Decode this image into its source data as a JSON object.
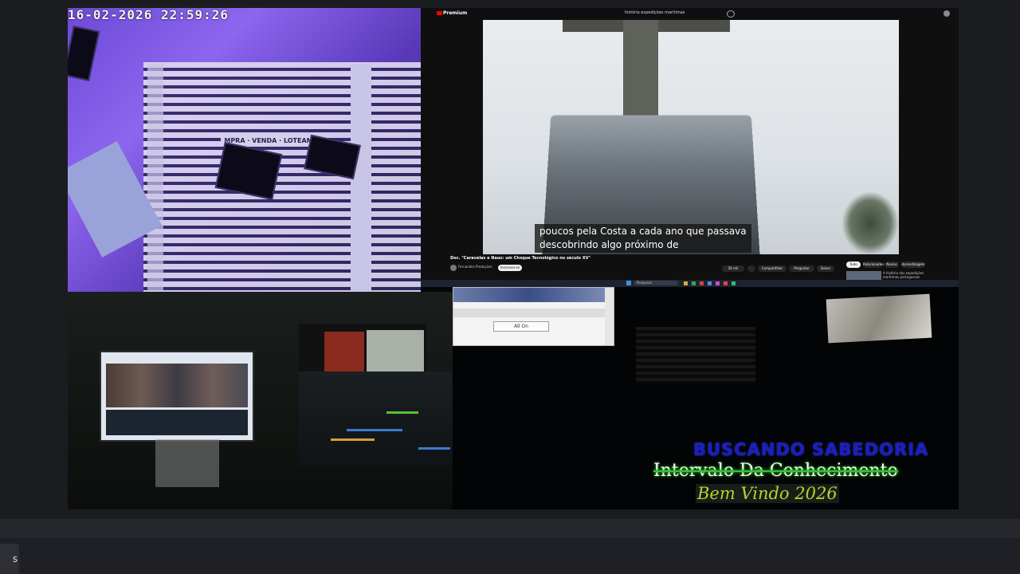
{
  "camera": {
    "timestamp": "16-02-2026  22:59:26",
    "sign_text": "MPRA · VENDA · LOTEAM"
  },
  "youtube": {
    "logo_text": "Premium",
    "search_text": "história expedições marítimas",
    "subtitle_line1": "poucos pela Costa a cada ano que passava",
    "subtitle_line2": "descobrindo algo próximo de",
    "video_title": "Doc. \"Caravelas e Naus: um Choque Tecnológico no século XV\"",
    "channel_name": "Fernandes Produções",
    "subscribe_label": "Inscrever-se",
    "buttons": [
      "56 mil",
      "Compartilhar",
      "Perguntar",
      "Salvar"
    ],
    "chips": [
      "Tudo",
      "Relacionados",
      "Navios",
      "Aprendizagem"
    ],
    "next_video": "A história das expedições marítimas portuguesas",
    "taskbar_search": "Pesquisar"
  },
  "dialog": {
    "all_on_label": "All On"
  },
  "overlay": {
    "line1": "BUSCANDO SABEDORIA",
    "line2": "Intervalo Da Conhecimento",
    "line3": "Bem Vindo 2026"
  },
  "bottom": {
    "corner_label": "s"
  },
  "colors": {
    "overlay_blue": "#1b1fbf",
    "overlay_green_glow": "#2eb22e",
    "overlay_yellow": "#b8d22d",
    "youtube_red": "#ff0000"
  }
}
